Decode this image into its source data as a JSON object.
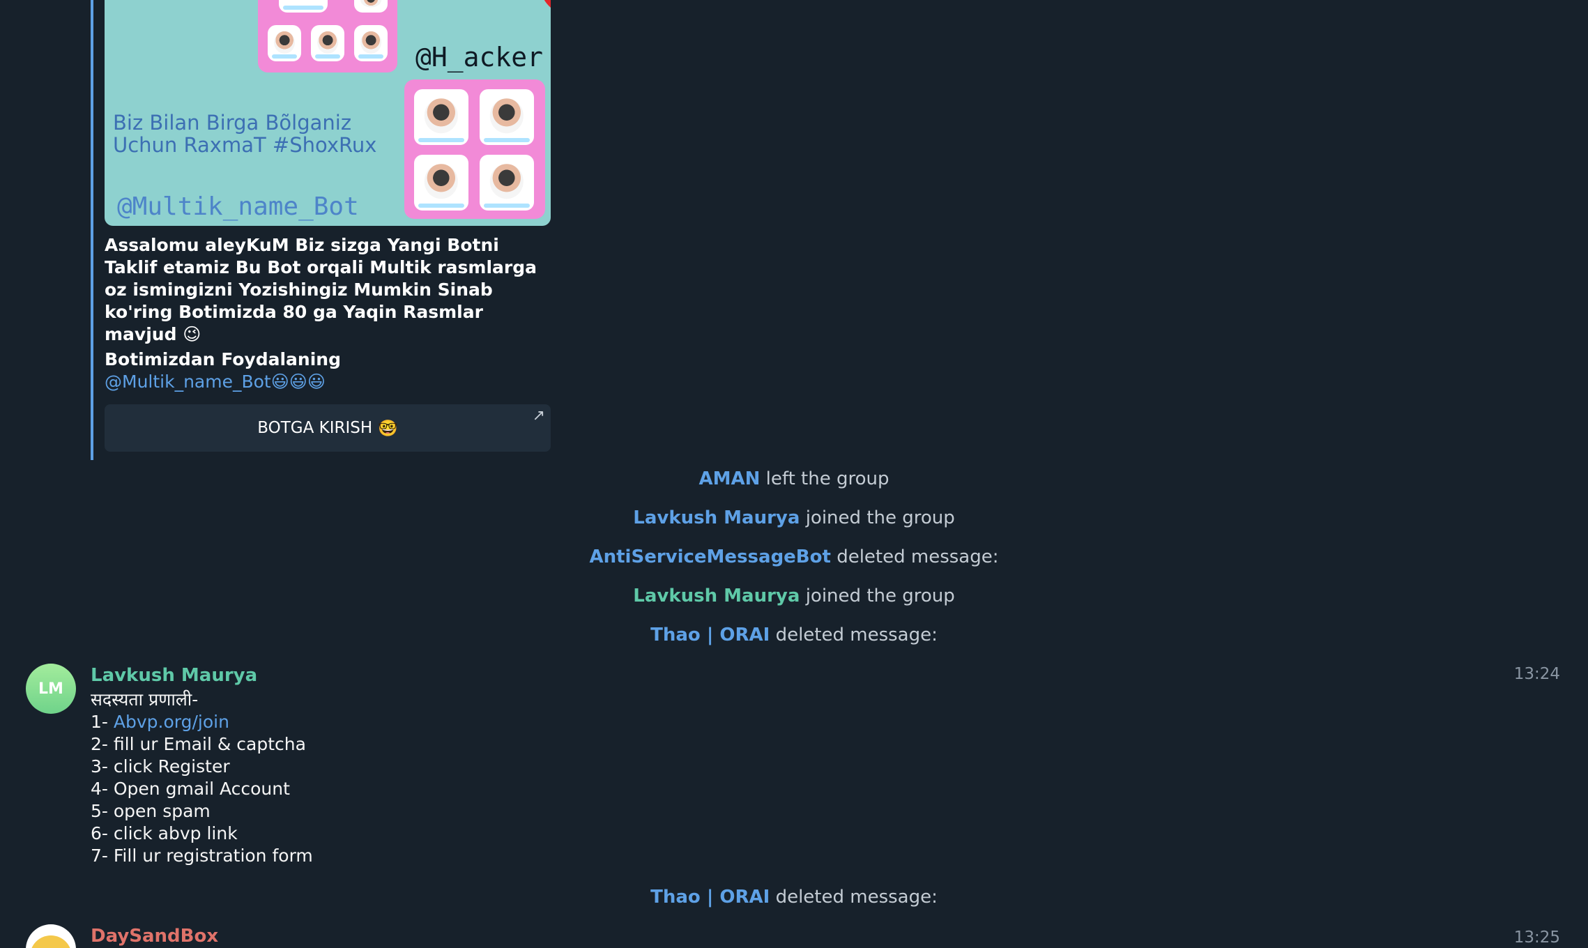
{
  "post": {
    "image": {
      "handle": "@H_acker",
      "tagline": "Biz Bilan Birga Bõlganiz Uchun RaxmaT #ShoxRux",
      "bot_name": "@Multik_name_Bot"
    },
    "text": "Assalomu aleyKuM Biz sizga Yangi Botni Taklif etamiz Bu Bot orqali Multik rasmlarga oz ismingizni Yozishingiz Mumkin Sinab ko'ring Botimizda 80 ga Yaqin Rasmlar mavjud",
    "wink_emoji": "😉",
    "subheading": "Botimizdan Foydalaning",
    "link": "@Multik_name_Bot",
    "emojis": "😃😃😃",
    "button_label": "BOTGA KIRISH",
    "button_emoji": "🤓",
    "button_arrow": "↗"
  },
  "service_messages": [
    {
      "actor": "AMAN",
      "action": "left the group"
    },
    {
      "actor": "Lavkush Maurya",
      "action": "joined the group"
    },
    {
      "actor": "AntiServiceMessageBot",
      "action": "deleted message:"
    },
    {
      "actor": "Lavkush Maurya",
      "action": "joined the group"
    },
    {
      "actor": "Thao | ORAI",
      "action": "deleted message:"
    }
  ],
  "message": {
    "avatar_initials": "LM",
    "sender": "Lavkush Maurya",
    "time": "13:24",
    "lines": [
      "सदस्यता प्रणाली-",
      "1- ",
      "2- fill ur Email & captcha",
      "3- click Register",
      "4- Open gmail Account",
      "5- open spam",
      "6- click abvp link",
      "7- Fill ur registration form"
    ],
    "link_text": "Abvp.org/join"
  },
  "service_after": {
    "actor": "Thao | ORAI",
    "action": "deleted message:"
  },
  "next_message": {
    "sender": "DaySandBox",
    "time": "13:25"
  },
  "colors": {
    "background": "#17212b",
    "link": "#5ea1e6",
    "name_teal": "#5fc9a8",
    "name_red": "#e0736a",
    "button_bg": "#212e3b"
  }
}
